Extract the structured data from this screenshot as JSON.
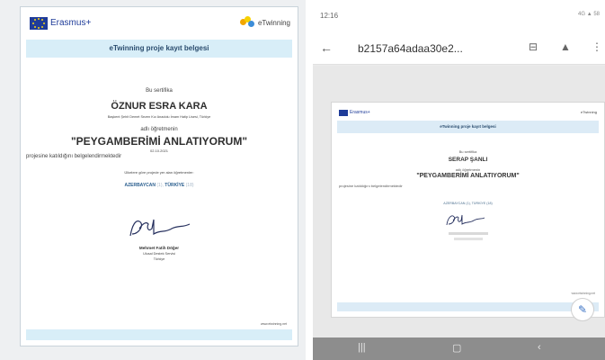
{
  "certificate": {
    "program_logo": "Erasmus+",
    "etwinning_logo": "eTwinning",
    "header": "eTwinning proje kayıt belgesi",
    "intro": "Bu sertifika",
    "recipient": "ÖZNUR ESRA KARA",
    "school": "Başkent Şehit Demet Sezen Kız Anadolu İmam Hatip Lisesi, Türkiye",
    "role": "adlı öğretmenin",
    "project": "\"PEYGAMBERİMİ ANLATIYORUM\"",
    "date": "02.10.2021",
    "participation": "projesine katıldığını belgelendirmektedir",
    "countries_intro": "Ülkelere göre projede yer alan öğretmenler:",
    "country_1": "AZERBAYCAN",
    "country_1_count": "(1)",
    "country_2": "TÜRKİYE",
    "country_2_count": "(18)",
    "signer": "Mehmet Fatih Döğer",
    "signer_org": "Ulusal Destek Servisi",
    "signer_country": "Türkiye",
    "url": "www.etwinning.net"
  },
  "phone": {
    "time": "12:16",
    "status_right": "4G ▲ 58",
    "file_title": "b2157a64adaa30e2...",
    "icons": [
      "back-arrow-icon",
      "message-icon",
      "drive-icon",
      "more-icon",
      "edit-icon",
      "recents-icon",
      "home-icon",
      "back-nav-icon"
    ],
    "page": {
      "program_logo": "Erasmus+",
      "etwinning_logo": "eTwinning",
      "header": "eTwinning proje kayıt belgesi",
      "intro": "Bu sertifika",
      "recipient": "SERAP ŞANLI",
      "role": "adlı öğretmenin",
      "project": "\"PEYGAMBERİMİ ANLATIYORUM\"",
      "participation": "projesine katıldığını belgelendirmektedir",
      "countries": "AZERBAYCAN (1), TÜRKİYE (18)",
      "url": "www.etwinning.net"
    }
  },
  "colors": {
    "eu_blue": "#1f3c99",
    "band": "#d8eef8",
    "nav": "#8d8d8d"
  }
}
